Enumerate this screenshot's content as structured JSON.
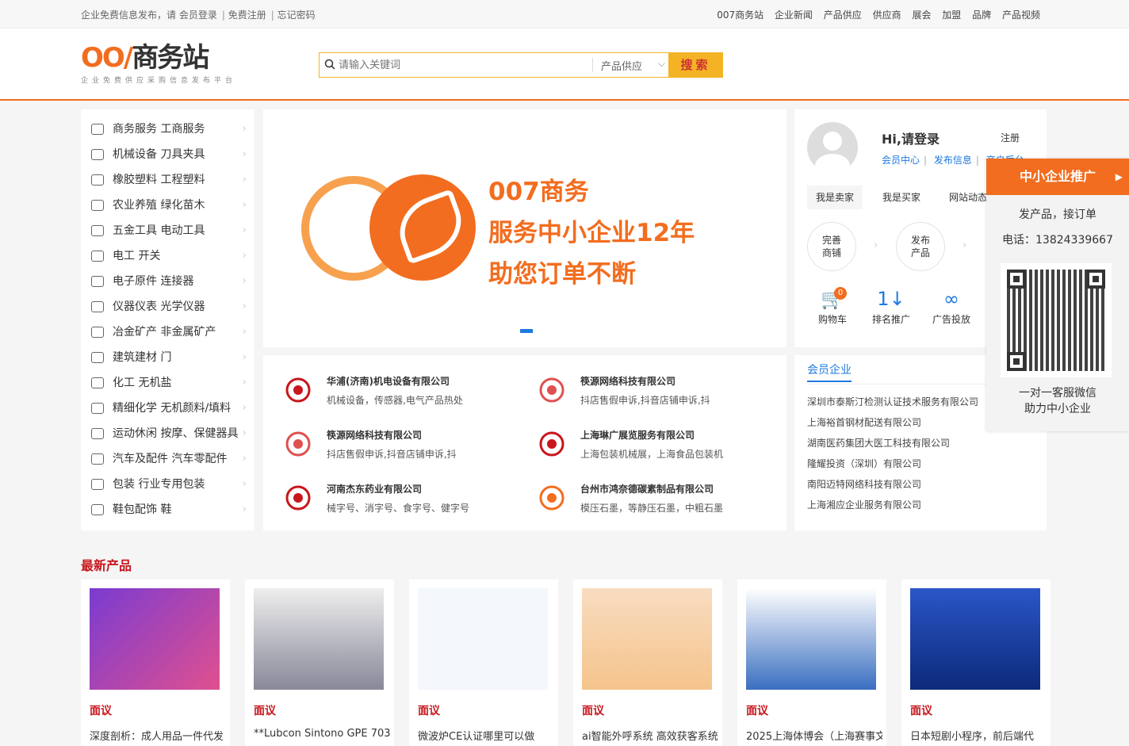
{
  "topbar": {
    "notice": "企业免费信息发布，请",
    "login": "会员登录",
    "register": "免费注册",
    "forgot": "忘记密码",
    "nav": [
      "007商务站",
      "企业新闻",
      "产品供应",
      "供应商",
      "展会",
      "加盟",
      "品牌",
      "产品视频"
    ]
  },
  "logo": {
    "mark": "OO/",
    "name": "商务站",
    "slogan": "企业免费供应采购信息发布平台"
  },
  "search": {
    "placeholder": "请输入关键词",
    "category": "产品供应",
    "button": "搜索"
  },
  "categories": [
    "商务服务 工商服务",
    "机械设备 刀具夹具",
    "橡胶塑料 工程塑料",
    "农业养殖 绿化苗木",
    "五金工具 电动工具",
    "电工 开关",
    "电子原件 连接器",
    "仪器仪表 光学仪器",
    "冶金矿产 非金属矿产",
    "建筑建材 门",
    "化工 无机盐",
    "精细化学 无机颜料/填料",
    "运动休闲 按摩、保健器具",
    "汽车及配件 汽车零配件",
    "包装 行业专用包装",
    "鞋包配饰 鞋"
  ],
  "banner": {
    "line1": "007商务",
    "line2": "服务中小企业12年",
    "line3": "助您订单不断"
  },
  "companies": [
    {
      "name": "华浦(济南)机电设备有限公司",
      "desc": "机械设备，传感器,电气产品热处"
    },
    {
      "name": "筷源网络科技有限公司",
      "desc": "抖店售假申诉,抖音店铺申诉,抖"
    },
    {
      "name": "筷源网络科技有限公司",
      "desc": "抖店售假申诉,抖音店铺申诉,抖"
    },
    {
      "name": "上海琳广展览服务有限公司",
      "desc": "上海包装机械展，上海食品包装机"
    },
    {
      "name": "河南杰东药业有限公司",
      "desc": "械字号、消字号、食字号、健字号"
    },
    {
      "name": "台州市鸿奈德碳素制品有限公司",
      "desc": "模压石墨，等静压石墨，中粗石墨"
    }
  ],
  "user": {
    "greeting": "Hi,请登录",
    "register": "注册",
    "links": [
      "会员中心",
      "发布信息",
      "商户后台"
    ],
    "tabs": [
      "我是卖家",
      "我是买家",
      "网站动态"
    ],
    "steps": [
      {
        "a": "完善",
        "b": "商铺"
      },
      {
        "a": "发布",
        "b": "产品"
      }
    ],
    "tools": [
      {
        "label": "购物车",
        "badge": "0"
      },
      {
        "label": "排名推广"
      },
      {
        "label": "广告投放"
      }
    ]
  },
  "members": {
    "title": "会员企业",
    "list": [
      "深圳市泰斯汀检测认证技术服务有限公司",
      "上海裕首钢材配送有限公司",
      "湖南医药集团大医工科技有限公司",
      "隆耀投资（深圳）有限公司",
      "南阳迈特网络科技有限公司",
      "上海湘应企业服务有限公司"
    ]
  },
  "promo": {
    "title": "中小企业推广",
    "line1": "发产品，接订单",
    "phone": "电话：13824339667",
    "foot1": "一对一客服微信",
    "foot2": "助力中小企业"
  },
  "latest": {
    "title": "最新产品",
    "items": [
      {
        "tag": "面议",
        "name": "深度剖析：成人用品一件代发"
      },
      {
        "tag": "面议",
        "name": "**Lubcon Sintono GPE 703"
      },
      {
        "tag": "面议",
        "name": "微波炉CE认证哪里可以做"
      },
      {
        "tag": "面议",
        "name": "ai智能外呼系统 高效获客系统"
      },
      {
        "tag": "面议",
        "name": "2025上海体博会（上海赛事文"
      },
      {
        "tag": "面议",
        "name": "日本短剧小程序，前后端代"
      }
    ]
  },
  "colors": {
    "brand": "#f26d1f",
    "link": "#1e7ae0",
    "price": "#c8161d",
    "search": "#f3b324"
  }
}
